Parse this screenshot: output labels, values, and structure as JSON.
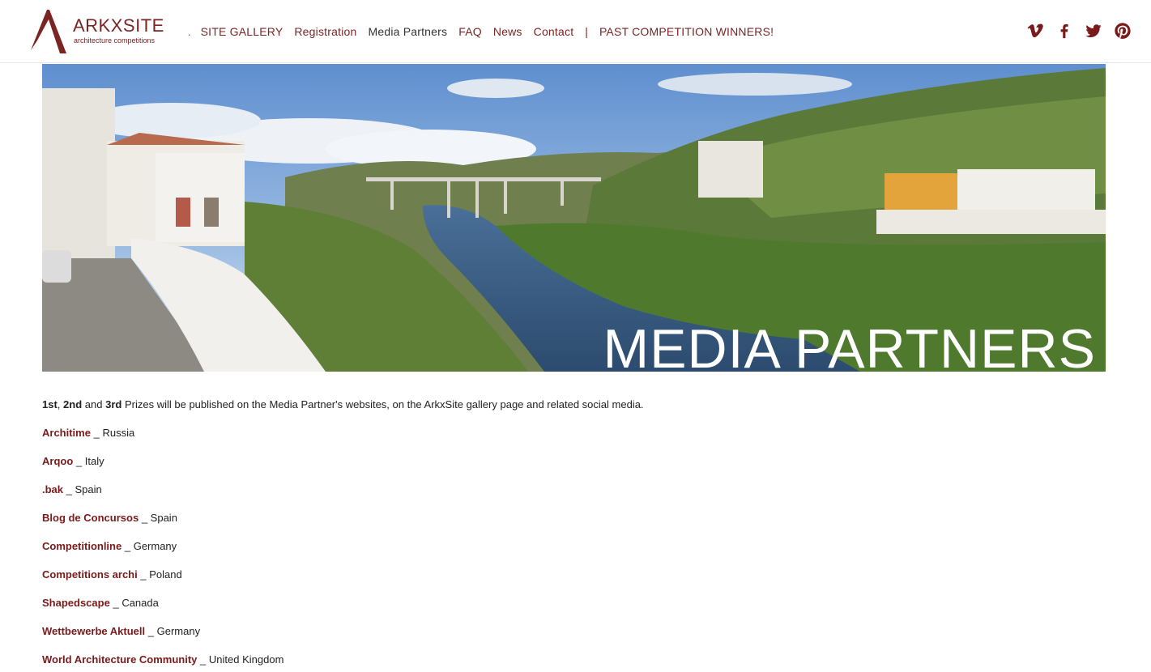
{
  "brand": {
    "name": "ARKXSITE",
    "tagline": "architecture competitions",
    "color": "#7a2424"
  },
  "nav": {
    "dot": ".",
    "items": [
      {
        "label": "SITE GALLERY"
      },
      {
        "label": "Registration"
      },
      {
        "label": "Media Partners"
      },
      {
        "label": "FAQ"
      },
      {
        "label": "News"
      },
      {
        "label": "Contact"
      }
    ],
    "separator": "|",
    "winners": "PAST COMPETITION WINNERS!"
  },
  "social": [
    {
      "icon": "vimeo-icon"
    },
    {
      "icon": "facebook-icon"
    },
    {
      "icon": "twitter-icon"
    },
    {
      "icon": "pinterest-icon"
    }
  ],
  "hero": {
    "title": "MEDIA PARTNERS"
  },
  "intro": {
    "first": "1st",
    "comma": ",",
    "second": "2nd",
    "and": "and",
    "third": "3rd",
    "rest": "Prizes will be published on the Media Partner's websites, on the ArkxSite gallery page and related social media."
  },
  "partners": [
    {
      "name": "Architime",
      "sep": "_",
      "country": "Russia"
    },
    {
      "name": "Arqoo",
      "sep": "_",
      "country": "Italy"
    },
    {
      "name": ".bak",
      "sep": "_",
      "country": "Spain"
    },
    {
      "name": "Blog de Concursos",
      "sep": "_",
      "country": "Spain"
    },
    {
      "name": "Competitionline",
      "sep": "_",
      "country": "Germany"
    },
    {
      "name": "Competitions archi",
      "sep": "_",
      "country": "Poland"
    },
    {
      "name": "Shapedscape",
      "sep": "_",
      "country": "Canada"
    },
    {
      "name": "Wettbewerbe Aktuell",
      "sep": "_",
      "country": "Germany"
    },
    {
      "name": "World Architecture Community",
      "sep": "_",
      "country": "United Kingdom"
    }
  ]
}
